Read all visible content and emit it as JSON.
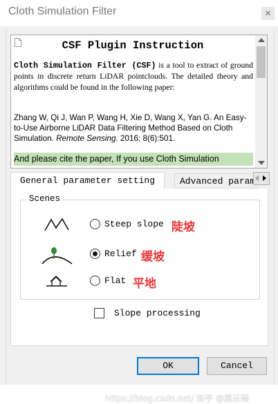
{
  "window": {
    "title": "Cloth Simulation Filter",
    "close_glyph": "×"
  },
  "info": {
    "title": "CSF Plugin Instruction",
    "para1_bold": "Cloth Simulation Filter (CSF)",
    "para1_rest": " is a tool to extract of ground points in discrete return LiDAR pointclouds. The detailed theory and algorithms could be found in the following paper:",
    "para2_pre": "Zhang W, Qi J, Wan P, Wang H, Xie D, Wang X, Yan G. An Easy-to-Use Airborne LiDAR Data Filtering Method Based on Cloth Simulation. ",
    "para2_journal": "Remote Sensing",
    "para2_post": ". 2016; 8(6):501.",
    "cite_line": "And please cite the paper, If you use Cloth Simulation"
  },
  "tabs": [
    {
      "label": "General parameter setting",
      "active": true
    },
    {
      "label": "Advanced parameter",
      "active": false
    }
  ],
  "scenes": {
    "legend": "Scenes",
    "options": [
      {
        "label": "Steep slope",
        "annotation": "陡坡",
        "checked": false,
        "icon": "steep-slope-icon"
      },
      {
        "label": "Relief",
        "annotation": "缓坡",
        "checked": true,
        "icon": "relief-icon"
      },
      {
        "label": "Flat",
        "annotation": "平地",
        "checked": false,
        "icon": "flat-icon"
      }
    ]
  },
  "slope_processing": {
    "label": "Slope processing",
    "checked": false
  },
  "buttons": {
    "ok": "OK",
    "cancel": "Cancel"
  },
  "watermark": "https://blog.csdn.net/ 知乎 @黑云雨",
  "colors": {
    "annotation_red": "#e8383b",
    "cite_highlight": "#c4e2b9",
    "ok_border": "#0078d7"
  }
}
